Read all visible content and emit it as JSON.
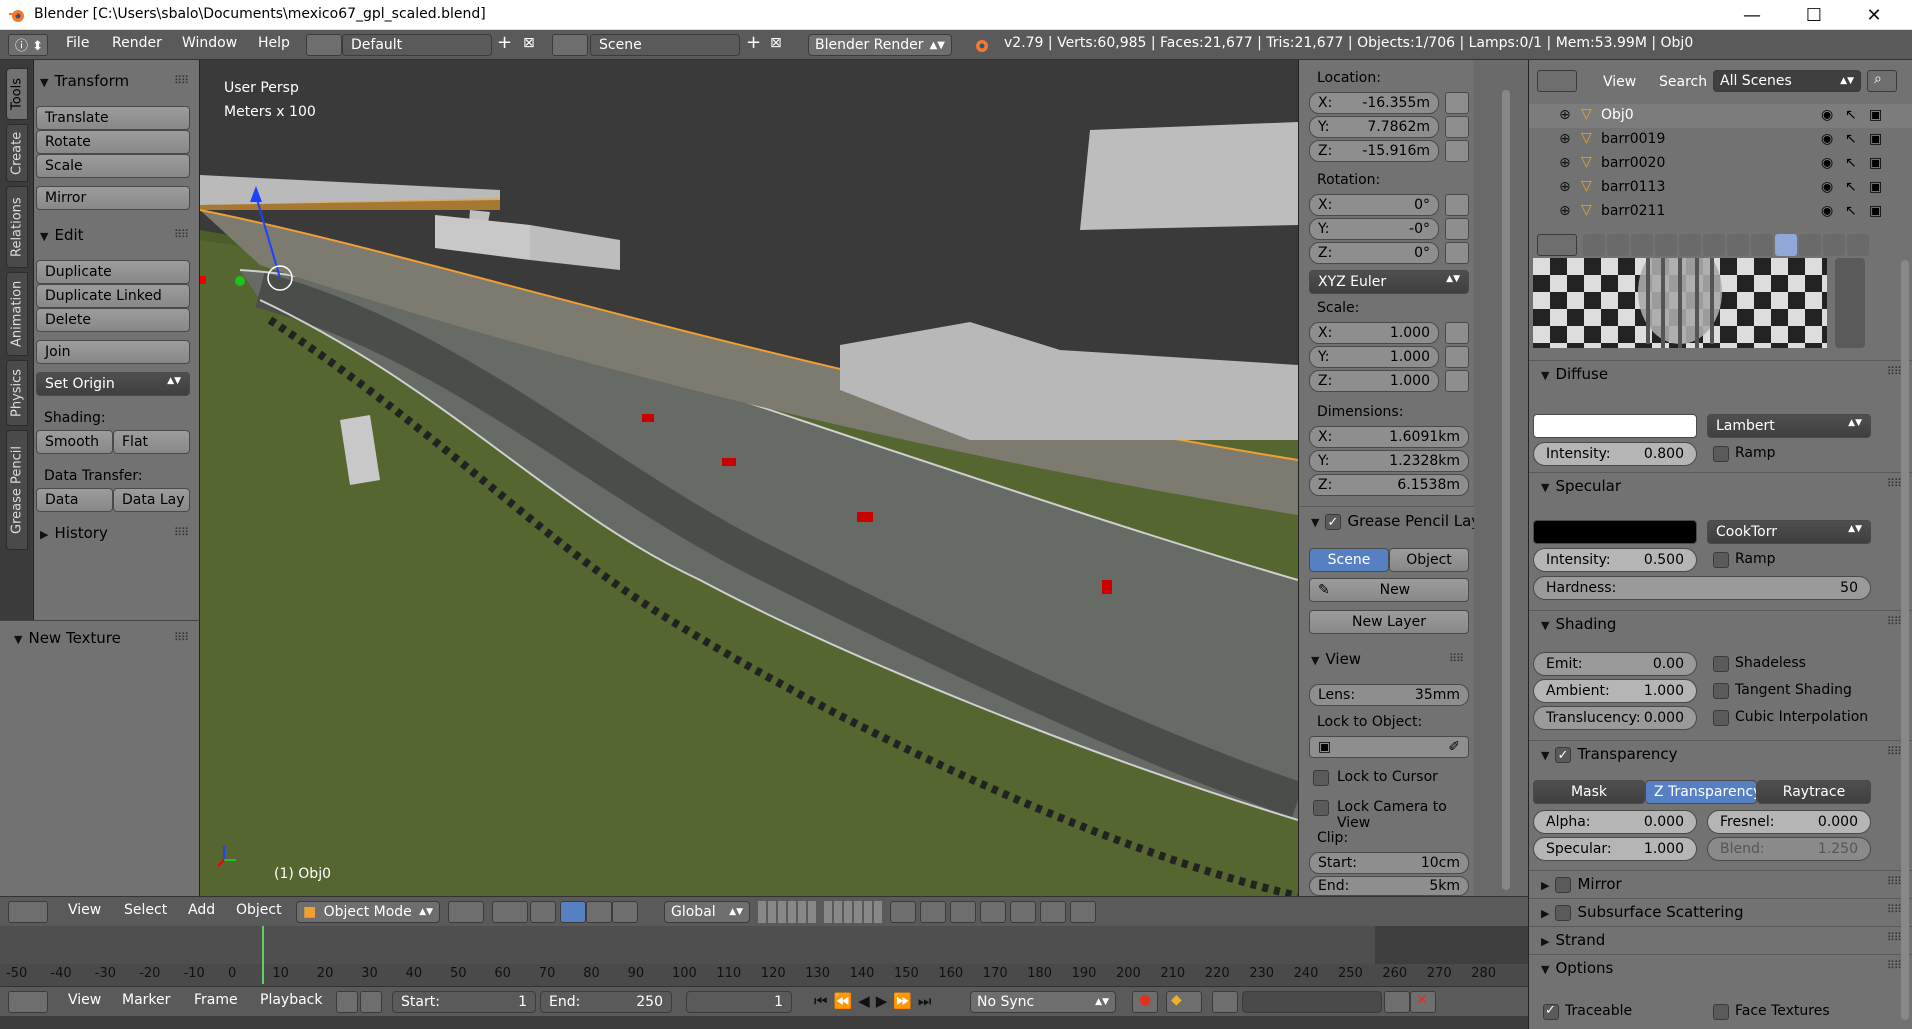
{
  "window": {
    "title": "Blender [C:\\Users\\sbalo\\Documents\\mexico67_gpl_scaled.blend]",
    "minimize": "—",
    "maximize": "☐",
    "close": "✕"
  },
  "infobar": {
    "menus": [
      "File",
      "Render",
      "Window",
      "Help"
    ],
    "layout": "Default",
    "scene": "Scene",
    "engine": "Blender Render",
    "stats": "v2.79 | Verts:60,985 | Faces:21,677 | Tris:21,677 | Objects:1/706 | Lamps:0/1 | Mem:53.99M | Obj0"
  },
  "toolshelf": {
    "tabs": [
      "Tools",
      "Create",
      "Relations",
      "Animation",
      "Physics",
      "Grease Pencil"
    ],
    "transform": {
      "title": "Transform",
      "buttons": [
        "Translate",
        "Rotate",
        "Scale",
        "Mirror"
      ]
    },
    "edit": {
      "title": "Edit",
      "buttons": [
        "Duplicate",
        "Duplicate Linked",
        "Delete",
        "Join",
        "Set Origin"
      ]
    },
    "shading_label": "Shading:",
    "shading_buttons": [
      "Smooth",
      "Flat"
    ],
    "data_transfer_label": "Data Transfer:",
    "data_buttons": [
      "Data",
      "Data Lay"
    ],
    "history": "History",
    "new_texture": "New Texture"
  },
  "viewport": {
    "persp": "User Persp",
    "units": "Meters x 100",
    "object": "(1) Obj0"
  },
  "npanel": {
    "location_label": "Location:",
    "location": [
      {
        "axis": "X:",
        "value": "-16.355m"
      },
      {
        "axis": "Y:",
        "value": "7.7862m"
      },
      {
        "axis": "Z:",
        "value": "-15.916m"
      }
    ],
    "rotation_label": "Rotation:",
    "rotation": [
      {
        "axis": "X:",
        "value": "0°"
      },
      {
        "axis": "Y:",
        "value": "-0°"
      },
      {
        "axis": "Z:",
        "value": "0°"
      }
    ],
    "rotation_mode": "XYZ Euler",
    "scale_label": "Scale:",
    "scale": [
      {
        "axis": "X:",
        "value": "1.000"
      },
      {
        "axis": "Y:",
        "value": "1.000"
      },
      {
        "axis": "Z:",
        "value": "1.000"
      }
    ],
    "dimensions_label": "Dimensions:",
    "dimensions": [
      {
        "axis": "X:",
        "value": "1.6091km"
      },
      {
        "axis": "Y:",
        "value": "1.2328km"
      },
      {
        "axis": "Z:",
        "value": "6.1538m"
      }
    ],
    "grease_title": "Grease Pencil Layer",
    "grease_scene": "Scene",
    "grease_object": "Object",
    "grease_new": "New",
    "grease_new_layer": "New Layer",
    "view_title": "View",
    "lens_label": "Lens:",
    "lens_value": "35mm",
    "lock_to_object": "Lock to Object:",
    "lock_cursor": "Lock to Cursor",
    "lock_camera": "Lock Camera to View",
    "clip_label": "Clip:",
    "clip_start_label": "Start:",
    "clip_start": "10cm",
    "clip_end_label": "End:",
    "clip_end": "5km"
  },
  "outliner": {
    "view": "View",
    "search": "Search",
    "filter": "All Scenes",
    "items": [
      "Obj0",
      "barr0019",
      "barr0020",
      "barr0113",
      "barr0211"
    ]
  },
  "properties": {
    "diffuse_title": "Diffuse",
    "diffuse_shader": "Lambert",
    "diffuse_intensity_label": "Intensity:",
    "diffuse_intensity": "0.800",
    "ramp": "Ramp",
    "specular_title": "Specular",
    "specular_shader": "CookTorr",
    "specular_intensity": "0.500",
    "hardness_label": "Hardness:",
    "hardness": "50",
    "shading_title": "Shading",
    "emit_label": "Emit:",
    "emit": "0.00",
    "ambient_label": "Ambient:",
    "ambient": "1.000",
    "translucency_label": "Translucency:",
    "translucency": "0.000",
    "shadeless": "Shadeless",
    "tangent": "Tangent Shading",
    "cubic": "Cubic Interpolation",
    "transparency_title": "Transparency",
    "trans_modes": [
      "Mask",
      "Z Transparency",
      "Raytrace"
    ],
    "alpha_label": "Alpha:",
    "alpha": "0.000",
    "fresnel_label": "Fresnel:",
    "fresnel": "0.000",
    "spec_label": "Specular:",
    "spec": "1.000",
    "blend_label": "Blend:",
    "blend": "1.250",
    "mirror": "Mirror",
    "sss": "Subsurface Scattering",
    "strand": "Strand",
    "options": "Options",
    "traceable": "Traceable",
    "face_textures": "Face Textures",
    "diffuse_color": "#ffffff",
    "specular_color": "#000000",
    "accent": "#5680c2"
  },
  "v3d_header": {
    "menus": [
      "View",
      "Select",
      "Add",
      "Object"
    ],
    "mode": "Object Mode",
    "orientation": "Global"
  },
  "timeline": {
    "ticks": [
      "-50",
      "-40",
      "-30",
      "-20",
      "-10",
      "0",
      "10",
      "20",
      "30",
      "40",
      "50",
      "60",
      "70",
      "80",
      "90",
      "100",
      "110",
      "120",
      "130",
      "140",
      "150",
      "160",
      "170",
      "180",
      "190",
      "200",
      "210",
      "220",
      "230",
      "240",
      "250",
      "260",
      "270",
      "280"
    ],
    "menus": [
      "View",
      "Marker",
      "Frame",
      "Playback"
    ],
    "start_label": "Start:",
    "start": "1",
    "end_label": "End:",
    "end": "250",
    "current": "1",
    "sync": "No Sync"
  }
}
